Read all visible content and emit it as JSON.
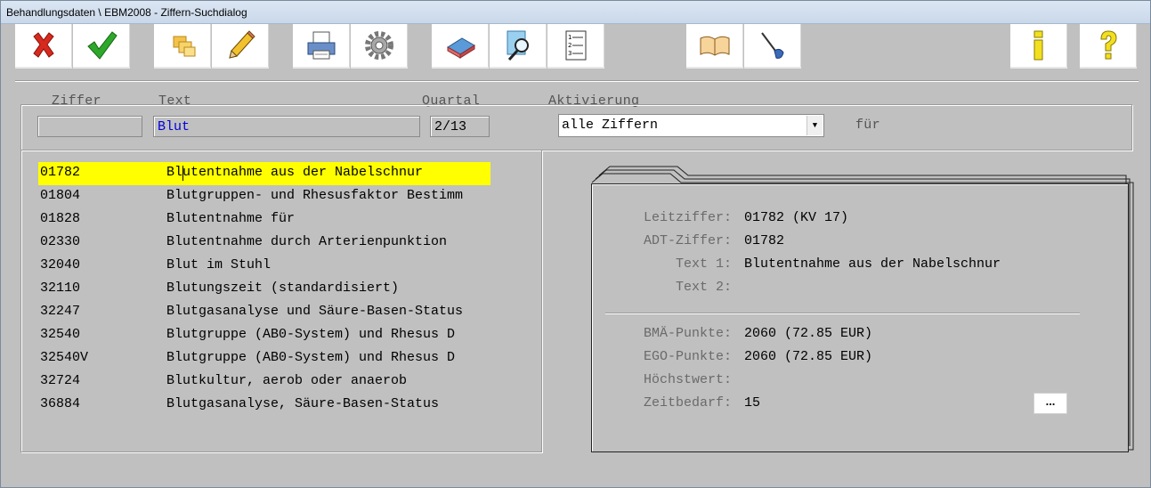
{
  "window": {
    "title": "Behandlungsdaten \\ EBM2008 - Ziffern-Suchdialog"
  },
  "toolbar": [
    {
      "name": "cancel-icon"
    },
    {
      "name": "ok-icon"
    },
    {
      "name": "boxes-icon"
    },
    {
      "name": "pencil-icon"
    },
    {
      "name": "printer-icon"
    },
    {
      "name": "gear-icon"
    },
    {
      "name": "eraser-icon"
    },
    {
      "name": "search-document-icon"
    },
    {
      "name": "numbered-list-icon"
    },
    {
      "name": "book-icon"
    },
    {
      "name": "pen-hand-icon"
    },
    {
      "name": "info-icon"
    },
    {
      "name": "help-icon"
    }
  ],
  "filters": {
    "ziffer_label_first": "Z",
    "ziffer_label_rest": "iffer",
    "text_label_first": "T",
    "text_label_rest": "ext",
    "quartal_label_first": "Q",
    "quartal_label_rest": "uartal",
    "aktivierung_label_first": "A",
    "aktivierung_label_rest": "ktivierung",
    "ziffer_value": "",
    "text_value": "Blut",
    "quartal_value": "2/13",
    "aktivierung_value": "alle Ziffern",
    "fuer_label": "für"
  },
  "results": [
    {
      "code": "01782",
      "text": "Blutentnahme aus der Nabelschnur"
    },
    {
      "code": "01804",
      "text": "Blutgruppen- und Rhesusfaktor Bestimm"
    },
    {
      "code": "01828",
      "text": "Blutentnahme für"
    },
    {
      "code": "02330",
      "text": "Blutentnahme durch Arterienpunktion"
    },
    {
      "code": "32040",
      "text": "Blut im Stuhl"
    },
    {
      "code": "32110",
      "text": "Blutungszeit (standardisiert)"
    },
    {
      "code": "32247",
      "text": "Blutgasanalyse und Säure-Basen-Status"
    },
    {
      "code": "32540",
      "text": "Blutgruppe (AB0-System) und Rhesus D"
    },
    {
      "code": "32540V",
      "text": "Blutgruppe (AB0-System) und Rhesus D"
    },
    {
      "code": "32724",
      "text": "Blutkultur, aerob oder anaerob"
    },
    {
      "code": "36884",
      "text": "Blutgasanalyse, Säure-Basen-Status"
    }
  ],
  "detail": {
    "leitziffer_label": "Leitziffer:",
    "leitziffer_value": "01782 (KV 17)",
    "adt_label": "ADT-Ziffer:",
    "adt_value": "01782",
    "text1_label": "Text 1:",
    "text1_value": "Blutentnahme aus der Nabelschnur",
    "text2_label": "Text 2:",
    "text2_value": "",
    "bma_label": "BMÄ-Punkte:",
    "bma_value": "2060 (72.85 EUR)",
    "ego_label": "EGO-Punkte:",
    "ego_value": "2060 (72.85 EUR)",
    "hoechst_label": "Höchstwert:",
    "hoechst_value": "",
    "zeit_label": "Zeitbedarf:",
    "zeit_value": "15",
    "more_label": "..."
  }
}
